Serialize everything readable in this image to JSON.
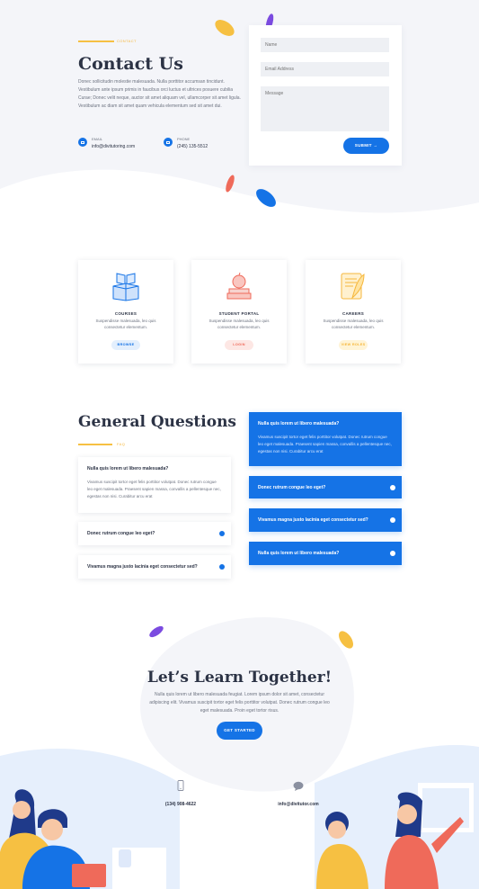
{
  "contact": {
    "tag": "CONTACT",
    "title": "Contact Us",
    "body": "Donec sollicitudin molestie malesuada. Nulla porttitor accumsan tincidunt. Vestibulum ante ipsum primis in faucibus orci luctus et ultrices posuere cubilia Curae; Donec velit neque, auctor sit amet aliquam vel, ullamcorper sit amet ligula. Vestibulum ac diam sit amet quam vehicula elementum sed sit amet dui.",
    "email_label": "EMAIL",
    "email_value": "info@divitutoring.com",
    "phone_label": "PHONE",
    "phone_value": "(245) 135-5512"
  },
  "form": {
    "name_placeholder": "Name",
    "email_placeholder": "Email Address",
    "message_placeholder": "Message",
    "submit_label": "SUBMIT →"
  },
  "cards": [
    {
      "title": "COURSES",
      "desc": "Suspendisse malesuada, leo quis consectetur elementum.",
      "button": "BROWSE",
      "color": "#1573e6"
    },
    {
      "title": "STUDENT PORTAL",
      "desc": "Suspendisse malesuada, leo quis consectetur elementum.",
      "button": "LOGIN",
      "color": "#ef6a5a"
    },
    {
      "title": "CAREERS",
      "desc": "Suspendisse malesuada, leo quis consectetur elementum.",
      "button": "VIEW ROLES",
      "color": "#f6c042"
    }
  ],
  "faq": {
    "title": "General Questions",
    "tag": "FAQ",
    "left": [
      {
        "q": "Nulla quis lorem ut libero malesuada?",
        "a": "Vivamus suscipit tortor eget felis porttitor volutpat. Donec rutrum congue leo eget malesuada. Praesent sapien massa, convallis a pellentesque nec, egestas non nisi. Curabitur arcu erat",
        "open": true
      },
      {
        "q": "Donec rutrum congue leo eget?",
        "open": false
      },
      {
        "q": "Vivamus magna justo lacinia eget consectetur sed?",
        "open": false
      }
    ],
    "right": [
      {
        "q": "Nulla quis lorem ut libero malesuada?",
        "a": "Vivamus suscipit tortor eget felis porttitor volutpat. Donec rutrum congue leo eget malesuada. Praesent sapien massa, convallis a pellentesque nec, egestas non nisi. Curabitur arcu erat",
        "open": true
      },
      {
        "q": "Donec rutrum congue leo eget?",
        "open": false
      },
      {
        "q": "Vivamus magna justo lacinia eget consectetur sed?",
        "open": false
      },
      {
        "q": "Nulla quis lorem ut libero malesuada?",
        "open": false
      }
    ]
  },
  "cta": {
    "title": "Let’s Learn Together!",
    "body": "Nulla quis lorem ut libero malesuada feugiat. Lorem ipsum dolor sit amet, consectetur adipiscing elit. Vivamus suscipit tortor eget felis porttitor volutpat. Donec rutrum congue leo eget malesuada. Proin eget tortor risus.",
    "button": "GET STARTED",
    "phone": "(134) 908-4622",
    "email": "info@divitutor.com"
  },
  "icons": {
    "phone": "smartphone-icon",
    "chat": "chat-bubble-icon",
    "email": "email-icon",
    "toggle": "plus-circle-icon"
  },
  "colors": {
    "primary": "#1573e6",
    "accent_yellow": "#f6c042",
    "accent_red": "#ef6a5a",
    "accent_purple": "#7b4be0",
    "heading": "#2c3345",
    "light_bg": "#f4f5f9"
  }
}
